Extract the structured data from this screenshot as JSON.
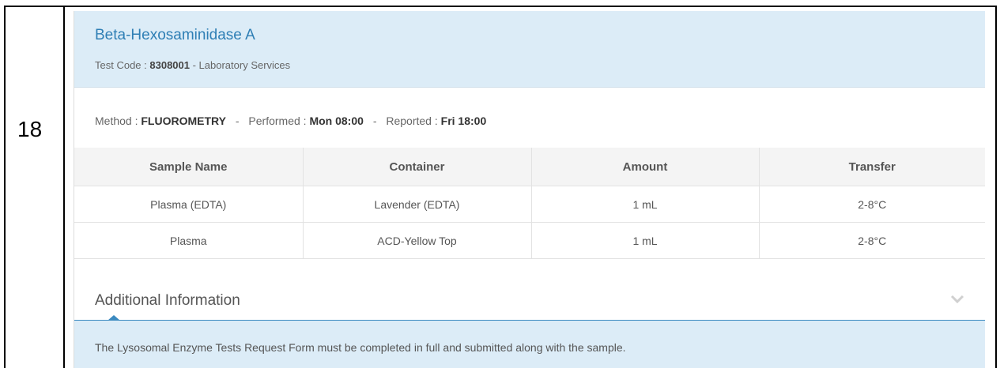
{
  "row_number": "18",
  "test": {
    "name": "Beta-Hexosaminidase A",
    "code_label": "Test Code : ",
    "code": "8308001",
    "code_suffix": " - Laboratory Services"
  },
  "method": {
    "method_label": "Method : ",
    "method_value": "FLUOROMETRY",
    "performed_label": "Performed : ",
    "performed_value": "Mon 08:00",
    "reported_label": "Reported : ",
    "reported_value": "Fri 18:00",
    "separator": "-"
  },
  "samples": {
    "headers": [
      "Sample Name",
      "Container",
      "Amount",
      "Transfer"
    ],
    "rows": [
      [
        "Plasma (EDTA)",
        "Lavender (EDTA)",
        "1 mL",
        "2-8°C"
      ],
      [
        "Plasma",
        "ACD-Yellow Top",
        "1 mL",
        "2-8°C"
      ]
    ]
  },
  "additional": {
    "title": "Additional Information",
    "text": "The Lysosomal Enzyme Tests Request Form must be completed in full and submitted along with the sample.",
    "toggle_icon": "chevron-down-icon"
  },
  "colors": {
    "header_bg": "#dcecf7",
    "title_blue": "#2f7fb5",
    "accent_line": "#3b8ac0"
  }
}
